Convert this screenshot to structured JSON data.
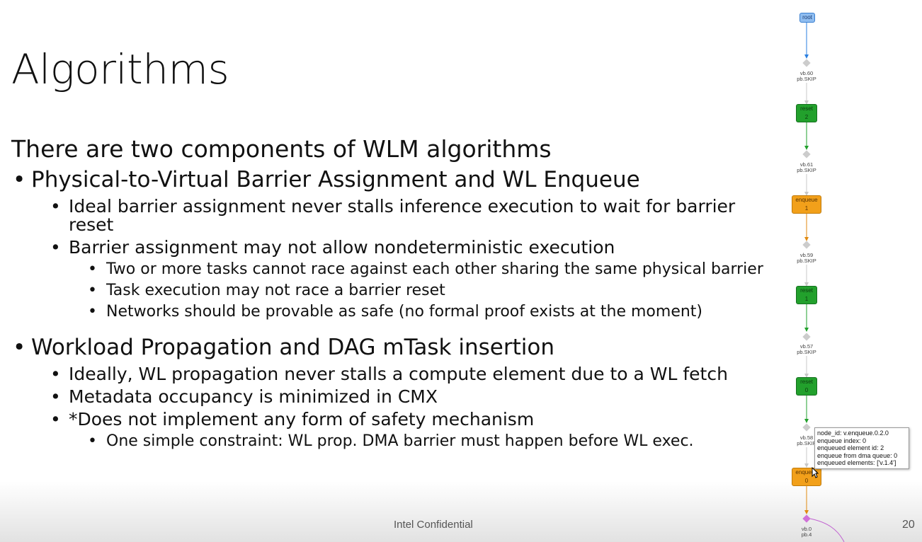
{
  "slide": {
    "title": "Algorithms",
    "intro": "There are two components of WLM algorithms",
    "section1": {
      "heading": "Physical-to-Virtual Barrier Assignment and WL Enqueue",
      "item1": "Ideal barrier assignment never stalls inference execution to wait for barrier reset",
      "item2": "Barrier assignment may not allow nondeterministic execution",
      "sub1": "Two or more tasks cannot race against each other sharing the same physical barrier",
      "sub2": "Task execution may not race a barrier reset",
      "sub3": "Networks should be provable as safe (no formal proof exists at the moment)"
    },
    "section2": {
      "heading": "Workload Propagation and DAG mTask insertion",
      "item1": "Ideally, WL propagation never stalls a compute element due to a WL fetch",
      "item2": "Metadata occupancy is minimized in CMX",
      "item3": "*Does not implement any form of safety mechanism",
      "sub1": "One simple constraint: WL prop. DMA barrier must happen before WL exec."
    },
    "footer": "Intel Confidential",
    "page_number": "20"
  },
  "graph": {
    "root": "root",
    "v60a": "vb.60",
    "v60b": "pb.SKIP",
    "reset2": "reset 2",
    "v61a": "vb.61",
    "v61b": "pb.SKIP",
    "enqueue1": "enqueue 1",
    "v59a": "vb.59",
    "v59b": "pb.SKIP",
    "reset1": "reset 1",
    "v57a": "vb.57",
    "v57b": "pb.SKIP",
    "reset0": "reset 0",
    "v58a": "vb.58",
    "v58b": "pb.SKIP",
    "enqueue0": "enqueue 0",
    "v0a": "vb.0",
    "v0b": "pb.4",
    "colors": {
      "root": "#8fbdf0",
      "reset": "#22a02c",
      "enqueue": "#f2a01a",
      "vnode": "#cccccc",
      "pnode": "#d070d8"
    }
  },
  "tooltip": {
    "line1": "node_id: v.enqueue.0.2.0",
    "line2": "enqueue index: 0",
    "line3": "enqueued element id: 2",
    "line4": "enqueue from dma queue: 0",
    "line5": "enqueued elements: ['v.1.4']"
  }
}
